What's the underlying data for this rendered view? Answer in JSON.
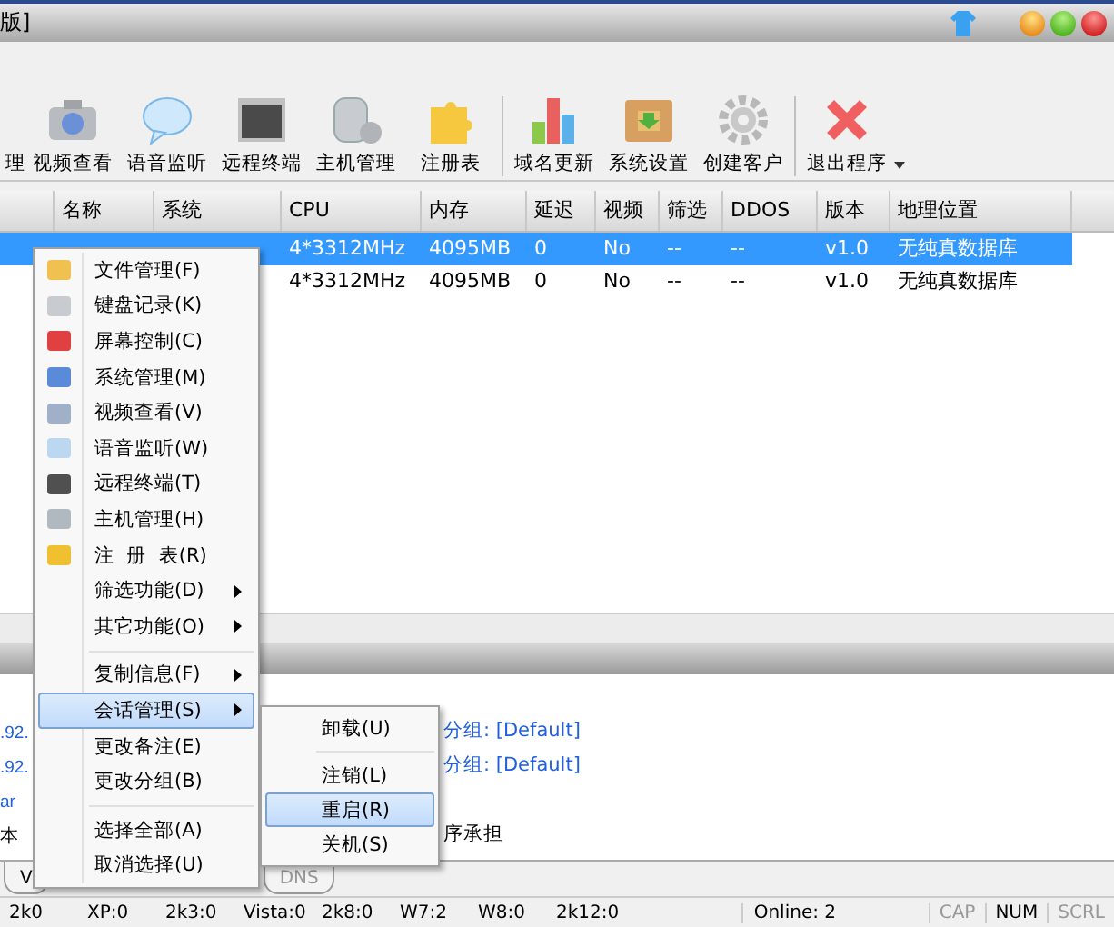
{
  "window": {
    "title": "版]"
  },
  "toolbar": {
    "groups": [
      [
        {
          "label": "理",
          "kind": "none"
        },
        {
          "label": "视频查看",
          "kind": "camera"
        },
        {
          "label": "语音监听",
          "kind": "bubble"
        },
        {
          "label": "远程终端",
          "kind": "terminal"
        },
        {
          "label": "主机管理",
          "kind": "database"
        },
        {
          "label": "注册表",
          "kind": "puzzle"
        }
      ],
      [
        {
          "label": "域名更新",
          "kind": "bars"
        },
        {
          "label": "系统设置",
          "kind": "box"
        },
        {
          "label": "创建客户",
          "kind": "gear"
        }
      ],
      [
        {
          "label": "退出程序",
          "kind": "cross"
        }
      ]
    ]
  },
  "table": {
    "columns": [
      "名称",
      "系统",
      "CPU",
      "内存",
      "延迟",
      "视频",
      "筛选",
      "DDOS",
      "版本",
      "地理位置"
    ],
    "rows": [
      {
        "selected": true,
        "cells": [
          "",
          "",
          "4*3312MHz",
          "4095MB",
          "0",
          "No",
          "--",
          "--",
          "v1.0",
          "无纯真数据库"
        ]
      },
      {
        "selected": false,
        "cells": [
          "",
          "",
          "4*3312MHz",
          "4095MB",
          "0",
          "No",
          "--",
          "--",
          "v1.0",
          "无纯真数据库"
        ]
      }
    ]
  },
  "context_menu": {
    "items": [
      {
        "label": "文件管理(F)",
        "kind": "command",
        "selected": false
      },
      {
        "label": "键盘记录(K)",
        "kind": "command",
        "selected": false
      },
      {
        "label": "屏幕控制(C)",
        "kind": "command",
        "selected": false
      },
      {
        "label": "系统管理(M)",
        "kind": "command",
        "selected": false
      },
      {
        "label": "视频查看(V)",
        "kind": "command",
        "selected": false
      },
      {
        "label": "语音监听(W)",
        "kind": "command",
        "selected": false
      },
      {
        "label": "远程终端(T)",
        "kind": "command",
        "selected": false
      },
      {
        "label": "主机管理(H)",
        "kind": "command",
        "selected": false
      },
      {
        "label": "注  册  表(R)",
        "kind": "command",
        "selected": false
      },
      {
        "label": "筛选功能(D)",
        "kind": "submenu",
        "selected": false
      },
      {
        "label": "其它功能(O)",
        "kind": "submenu",
        "selected": false
      },
      {
        "kind": "separator"
      },
      {
        "label": "复制信息(F)",
        "kind": "submenu",
        "selected": false
      },
      {
        "label": "会话管理(S)",
        "kind": "submenu",
        "selected": true
      },
      {
        "label": "更改备注(E)",
        "kind": "command",
        "selected": false
      },
      {
        "label": "更改分组(B)",
        "kind": "command",
        "selected": false
      },
      {
        "kind": "separator"
      },
      {
        "label": "选择全部(A)",
        "kind": "command",
        "selected": false
      },
      {
        "label": "取消选择(U)",
        "kind": "command",
        "selected": false
      }
    ]
  },
  "submenu": {
    "items": [
      {
        "label": "卸载(U)",
        "kind": "command",
        "selected": false
      },
      {
        "kind": "separator"
      },
      {
        "label": "注销(L)",
        "kind": "command",
        "selected": false
      },
      {
        "label": "重启(R)",
        "kind": "command",
        "selected": true
      },
      {
        "label": "关机(S)",
        "kind": "command",
        "selected": false
      }
    ]
  },
  "log": [
    {
      "kind": "link",
      "left": ".92.",
      "right": "分组: [Default]"
    },
    {
      "kind": "link",
      "left": ".92.",
      "right": "分组: [Default]"
    },
    {
      "kind": "link",
      "left": "ar"
    },
    {
      "kind": "plain",
      "left": "本",
      "right": "序承担"
    }
  ],
  "tabs": [
    {
      "label": "V",
      "disabled": false
    },
    {
      "label": "DNS",
      "disabled": true
    }
  ],
  "status_bar": {
    "counts": [
      "2k0",
      "XP:0",
      "2k3:0",
      "Vista:0",
      "2k8:0",
      "W7:2",
      "W8:0",
      "2k12:0"
    ],
    "online": "Online: 2",
    "keys": [
      {
        "label": "CAP",
        "on": false
      },
      {
        "label": "NUM",
        "on": true
      },
      {
        "label": "SCRL",
        "on": false
      }
    ]
  }
}
